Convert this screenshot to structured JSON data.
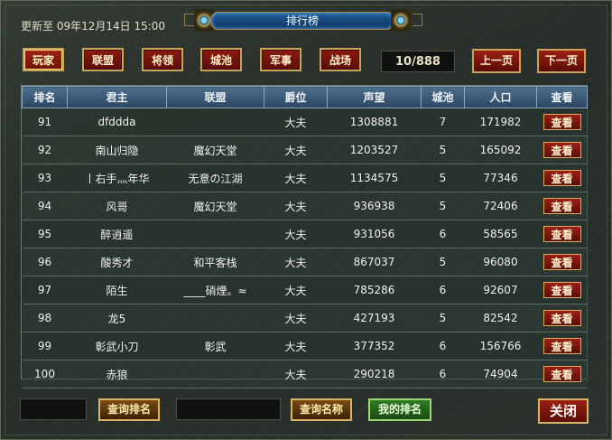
{
  "header": {
    "updated_text": "更新至 09年12月14日 15:00",
    "title": "排行榜"
  },
  "tabs": [
    {
      "label": "玩家",
      "active": true
    },
    {
      "label": "联盟",
      "active": false
    },
    {
      "label": "将领",
      "active": false
    },
    {
      "label": "城池",
      "active": false
    },
    {
      "label": "军事",
      "active": false
    },
    {
      "label": "战场",
      "active": false
    }
  ],
  "pagination": {
    "page_display": "10/888",
    "prev_label": "上一页",
    "next_label": "下一页"
  },
  "table": {
    "columns": [
      "排名",
      "君主",
      "联盟",
      "爵位",
      "声望",
      "城池",
      "人口",
      "查看"
    ],
    "view_label": "查看",
    "rows": [
      {
        "rank": "91",
        "lord": "dfddda",
        "alliance": "",
        "title": "大夫",
        "prestige": "1308881",
        "cities": "7",
        "population": "171982"
      },
      {
        "rank": "92",
        "lord": "南山归隐",
        "alliance": "魔幻天堂",
        "title": "大夫",
        "prestige": "1203527",
        "cities": "5",
        "population": "165092"
      },
      {
        "rank": "93",
        "lord": "丨右手灬年华",
        "alliance": "无意の江湖",
        "title": "大夫",
        "prestige": "1134575",
        "cities": "5",
        "population": "77346"
      },
      {
        "rank": "94",
        "lord": "风哥",
        "alliance": "魔幻天堂",
        "title": "大夫",
        "prestige": "936938",
        "cities": "5",
        "population": "72406"
      },
      {
        "rank": "95",
        "lord": "醉逍遥",
        "alliance": "",
        "title": "大夫",
        "prestige": "931056",
        "cities": "6",
        "population": "58565"
      },
      {
        "rank": "96",
        "lord": "酸秀才",
        "alliance": "和平客栈",
        "title": "大夫",
        "prestige": "867037",
        "cities": "5",
        "population": "96080"
      },
      {
        "rank": "97",
        "lord": "陌生",
        "alliance": "____硝煙。≈",
        "title": "大夫",
        "prestige": "785286",
        "cities": "6",
        "population": "92607"
      },
      {
        "rank": "98",
        "lord": "龙5",
        "alliance": "",
        "title": "大夫",
        "prestige": "427193",
        "cities": "5",
        "population": "82542"
      },
      {
        "rank": "99",
        "lord": "彰武小刀",
        "alliance": "彰武",
        "title": "大夫",
        "prestige": "377352",
        "cities": "6",
        "population": "156766"
      },
      {
        "rank": "100",
        "lord": "赤狼",
        "alliance": "",
        "title": "大夫",
        "prestige": "290218",
        "cities": "6",
        "population": "74904"
      }
    ]
  },
  "footer": {
    "rank_input_value": "",
    "query_rank_label": "查询排名",
    "name_input_value": "",
    "query_name_label": "查询名称",
    "my_rank_label": "我的排名",
    "close_label": "关闭"
  }
}
